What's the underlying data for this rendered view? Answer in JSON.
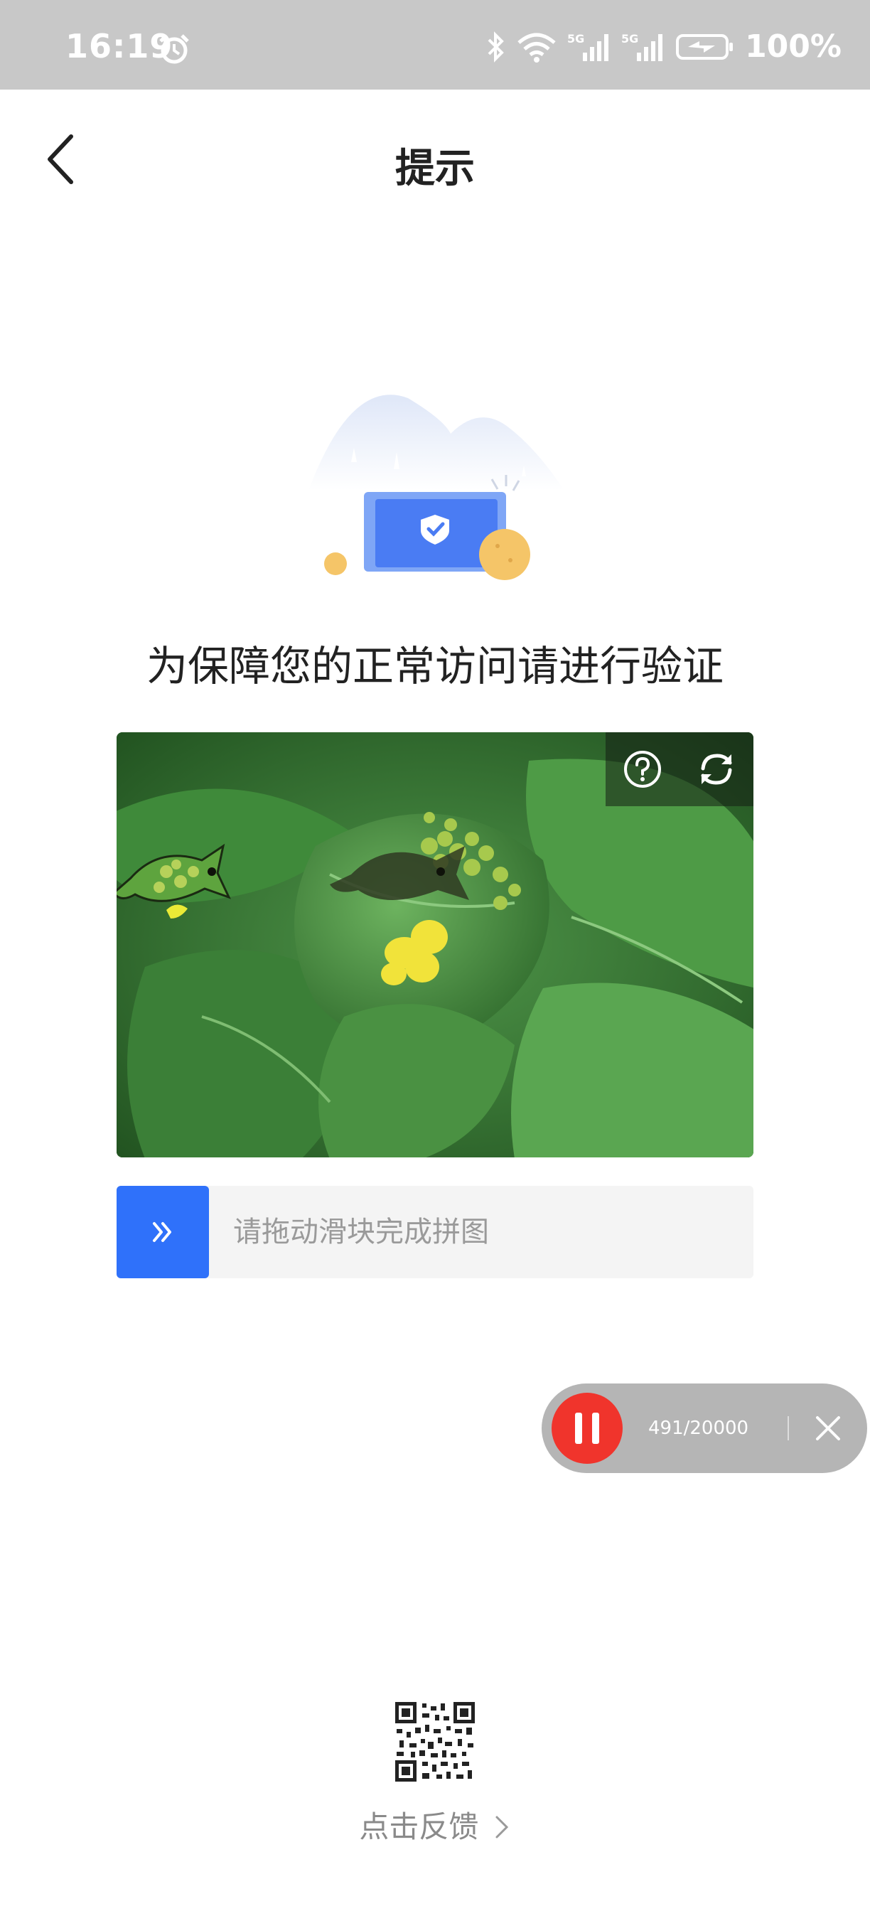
{
  "status_bar": {
    "time": "16:19",
    "battery": "100%",
    "network_label": "5G",
    "icons": [
      "alarm-icon",
      "bluetooth-icon",
      "wifi-icon",
      "signal-5g-icon",
      "signal-5g-icon",
      "battery-charging-icon"
    ]
  },
  "nav": {
    "title": "提示",
    "back_icon": "chevron-left-icon"
  },
  "page": {
    "headline": "为保障您的正常访问请进行验证",
    "colors": {
      "accent": "#2f71fa",
      "record": "#f0342c"
    }
  },
  "captcha": {
    "help_icon": "question-icon",
    "refresh_icon": "refresh-icon",
    "slider_hint": "请拖动滑块完成拼图",
    "slider_handle_icon": "double-chevron-right-icon"
  },
  "recorder": {
    "count": "491/20000",
    "pause_icon": "pause-icon",
    "close_icon": "close-icon"
  },
  "feedback": {
    "label": "点击反馈",
    "qr_icon": "qr-code-icon"
  }
}
